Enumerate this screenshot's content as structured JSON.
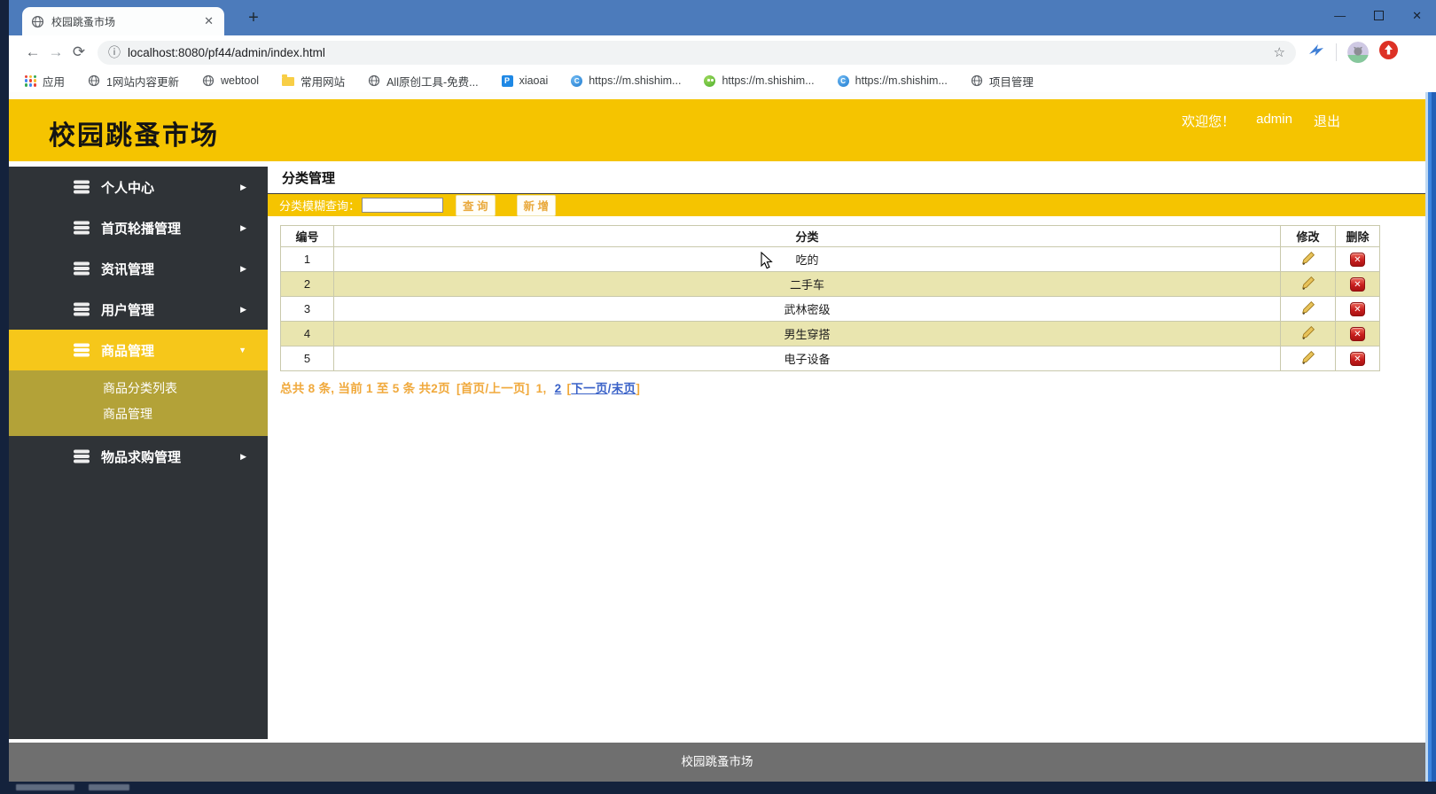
{
  "browser": {
    "tab_title": "校园跳蚤市场",
    "url": "localhost:8080/pf44/admin/index.html",
    "bookmarks": [
      {
        "label": "应用",
        "icon": "apps-grid-icon"
      },
      {
        "label": "1网站内容更新",
        "icon": "globe-icon"
      },
      {
        "label": "webtool",
        "icon": "globe-icon"
      },
      {
        "label": "常用网站",
        "icon": "folder-icon"
      },
      {
        "label": "All原创工具-免费...",
        "icon": "p-letter-icon"
      },
      {
        "label": "xiaoai",
        "icon": "p-badge-icon"
      },
      {
        "label": "https://m.shishim...",
        "icon": "blue-circle-icon"
      },
      {
        "label": "https://m.shishim...",
        "icon": "green-circle-icon"
      },
      {
        "label": "https://m.shishim...",
        "icon": "blue-circle-icon"
      },
      {
        "label": "项目管理",
        "icon": "globe-icon"
      }
    ]
  },
  "header": {
    "site_title": "校园跳蚤市场",
    "welcome": "欢迎您！",
    "username": "admin",
    "logout": "退出"
  },
  "sidebar": {
    "items": [
      {
        "label": "个人中心"
      },
      {
        "label": "首页轮播管理"
      },
      {
        "label": "资讯管理"
      },
      {
        "label": "用户管理"
      },
      {
        "label": "商品管理"
      },
      {
        "label": "物品求购管理"
      }
    ],
    "submenu": [
      {
        "label": "商品分类列表"
      },
      {
        "label": "商品管理"
      }
    ]
  },
  "main": {
    "page_title": "分类管理",
    "search": {
      "label": "分类模糊查询：",
      "input_value": "",
      "query_button": "查 询",
      "add_button": "新 增"
    },
    "table": {
      "headers": {
        "id": "编号",
        "category": "分类",
        "edit": "修改",
        "delete": "删除"
      },
      "rows": [
        {
          "id": "1",
          "category": "吃的"
        },
        {
          "id": "2",
          "category": "二手车"
        },
        {
          "id": "3",
          "category": "武林密级"
        },
        {
          "id": "4",
          "category": "男生穿搭"
        },
        {
          "id": "5",
          "category": "电子设备"
        }
      ]
    },
    "pagination": {
      "summary": "总共 8 条, 当前 1 至 5 条 共2页",
      "first_prev": "[首页/上一页]",
      "current_page": "1,",
      "page_2": "2",
      "open_bracket": "[",
      "next_page": "下一页",
      "separator": "/",
      "last_page": "末页",
      "close_bracket": "]"
    }
  },
  "footer": {
    "site_title": "校园跳蚤市场"
  },
  "colors": {
    "brand_yellow": "#F5C400",
    "active_menu_yellow": "#F6C71A",
    "submenu_olive": "#B3A238",
    "sidebar_dark": "#2F3337",
    "row_stripe": "#E9E5AF",
    "footer_gray": "#6F6F6F",
    "titlebar_blue": "#4C7BBB",
    "pagination_orange": "#F0A93C",
    "link_blue": "#3A62C8",
    "delete_red": "#C81E1E"
  }
}
